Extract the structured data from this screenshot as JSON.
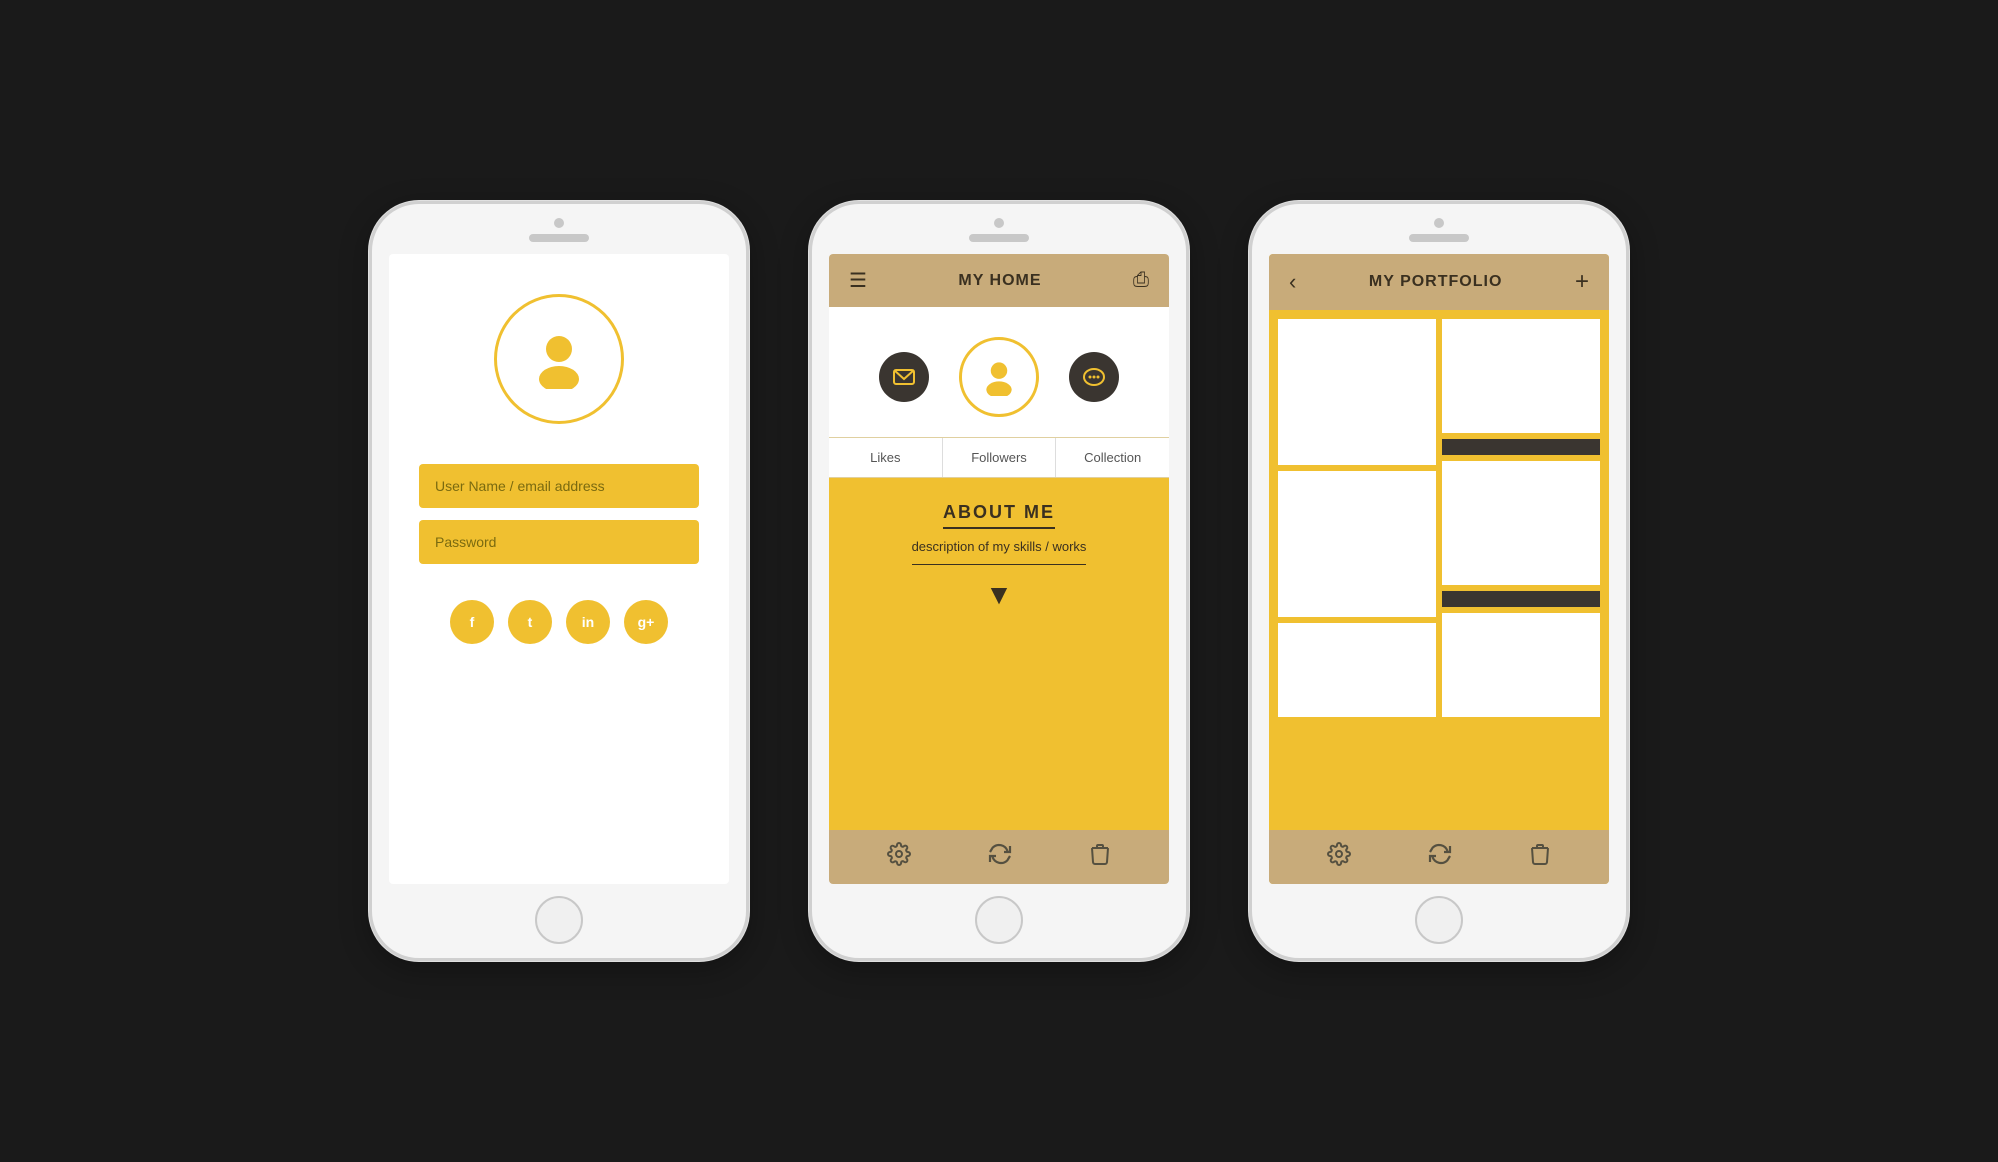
{
  "phone1": {
    "username_placeholder": "User Name / email address",
    "password_placeholder": "Password",
    "social": [
      "f",
      "t",
      "in",
      "g+"
    ]
  },
  "phone2": {
    "header": {
      "title": "MY HOME"
    },
    "tabs": [
      "Likes",
      "Followers",
      "Collection"
    ],
    "about": {
      "title": "ABOUT ME",
      "description": "description of my skills / works"
    },
    "toolbar": [
      "⚙",
      "↻",
      "🗑"
    ]
  },
  "phone3": {
    "header": {
      "title": "MY PORTFOLIO"
    },
    "toolbar": [
      "⚙",
      "↻",
      "🗑"
    ]
  },
  "colors": {
    "yellow": "#f0c030",
    "tan": "#c8ab7a",
    "dark": "#3a3530",
    "text_dark": "#3a3020"
  }
}
